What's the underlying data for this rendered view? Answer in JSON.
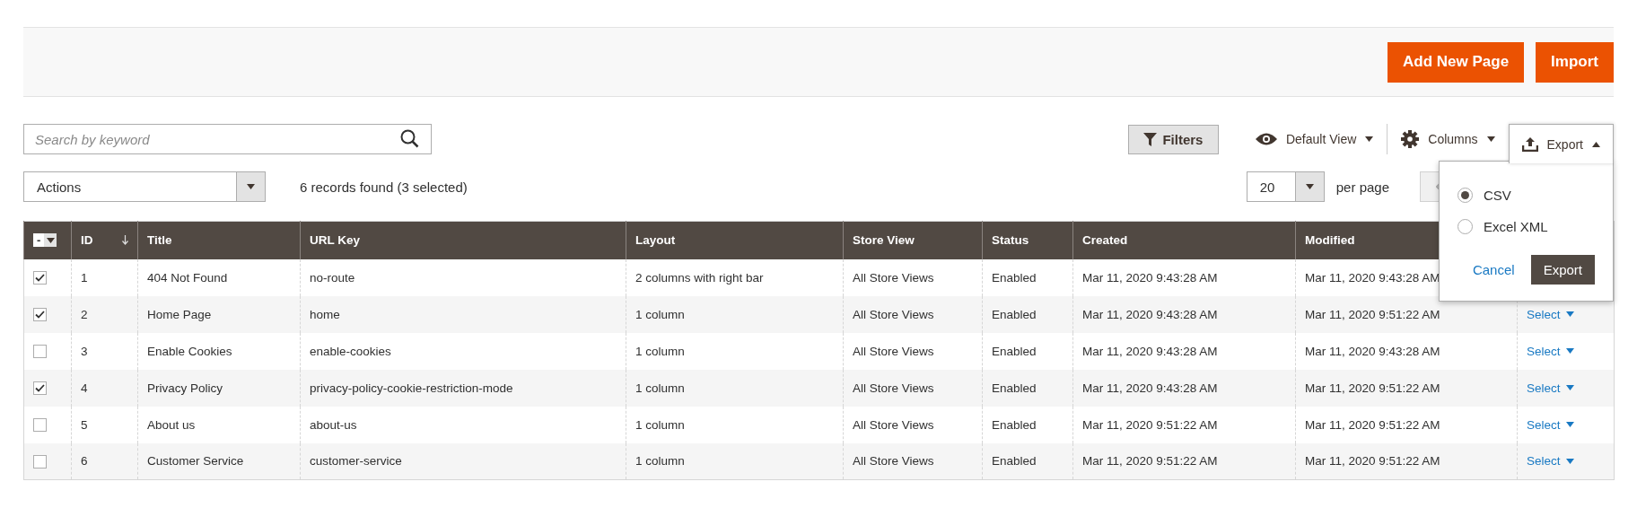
{
  "header_actions": [
    {
      "label": "Add New Page"
    },
    {
      "label": "Import"
    }
  ],
  "search": {
    "placeholder": "Search by keyword"
  },
  "toolbar": {
    "filters": "Filters",
    "view": "Default View",
    "columns": "Columns",
    "export": {
      "label": "Export",
      "expanded": true
    }
  },
  "mass_actions": {
    "value": "Actions"
  },
  "records": "6 records found (3 selected)",
  "pager": {
    "per_page_value": "20",
    "per_page_label": "per page"
  },
  "export_menu": {
    "options": [
      {
        "label": "CSV",
        "selected": true
      },
      {
        "label": "Excel XML",
        "selected": false
      }
    ],
    "cancel": "Cancel",
    "submit": "Export"
  },
  "table": {
    "mass_select": "-",
    "columns": [
      "ID",
      "Title",
      "URL Key",
      "Layout",
      "Store View",
      "Status",
      "Created",
      "Modified"
    ],
    "rows": [
      {
        "checked": true,
        "cells": [
          "1",
          "404 Not Found",
          "no-route",
          "2 columns with right bar",
          "All Store Views",
          "Enabled",
          "Mar 11, 2020 9:43:28 AM",
          "Mar 11, 2020 9:43:28 AM"
        ]
      },
      {
        "checked": true,
        "cells": [
          "2",
          "Home Page",
          "home",
          "1 column",
          "All Store Views",
          "Enabled",
          "Mar 11, 2020 9:43:28 AM",
          "Mar 11, 2020 9:51:22 AM"
        ],
        "action": "Select"
      },
      {
        "checked": false,
        "cells": [
          "3",
          "Enable Cookies",
          "enable-cookies",
          "1 column",
          "All Store Views",
          "Enabled",
          "Mar 11, 2020 9:43:28 AM",
          "Mar 11, 2020 9:43:28 AM"
        ],
        "action": "Select"
      },
      {
        "checked": true,
        "cells": [
          "4",
          "Privacy Policy",
          "privacy-policy-cookie-restriction-mode",
          "1 column",
          "All Store Views",
          "Enabled",
          "Mar 11, 2020 9:43:28 AM",
          "Mar 11, 2020 9:51:22 AM"
        ],
        "action": "Select"
      },
      {
        "checked": false,
        "cells": [
          "5",
          "About us",
          "about-us",
          "1 column",
          "All Store Views",
          "Enabled",
          "Mar 11, 2020 9:51:22 AM",
          "Mar 11, 2020 9:51:22 AM"
        ],
        "action": "Select"
      },
      {
        "checked": false,
        "cells": [
          "6",
          "Customer Service",
          "customer-service",
          "1 column",
          "All Store Views",
          "Enabled",
          "Mar 11, 2020 9:51:22 AM",
          "Mar 11, 2020 9:51:22 AM"
        ],
        "action": "Select"
      }
    ]
  }
}
